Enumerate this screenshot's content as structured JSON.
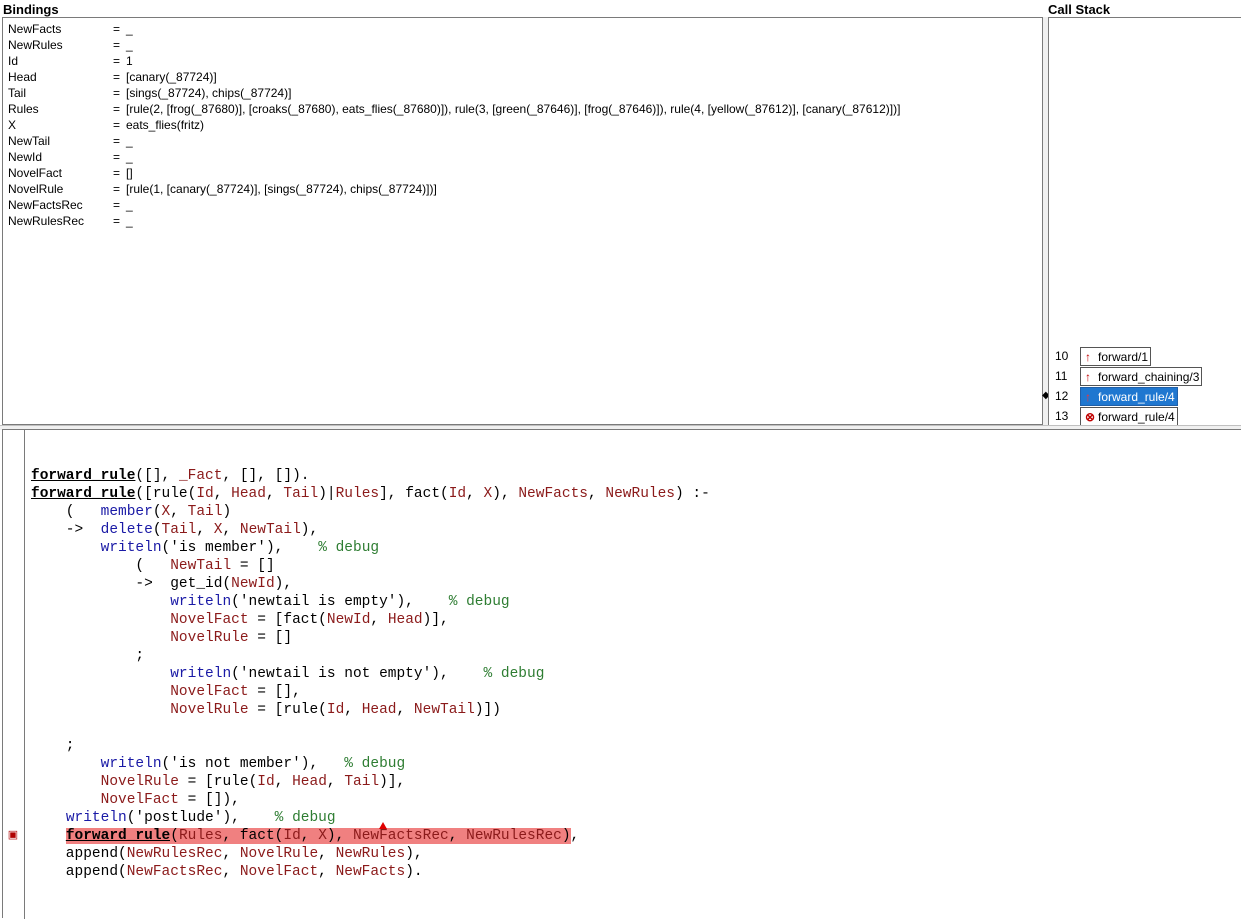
{
  "bindings": {
    "title": "Bindings",
    "rows": [
      {
        "name": "NewFacts",
        "eq": "=",
        "value": "_"
      },
      {
        "name": "NewRules",
        "eq": "=",
        "value": "_"
      },
      {
        "name": "Id",
        "eq": "=",
        "value": "1"
      },
      {
        "name": "Head",
        "eq": "=",
        "value": "[canary(_87724)]"
      },
      {
        "name": "Tail",
        "eq": "=",
        "value": "[sings(_87724), chips(_87724)]"
      },
      {
        "name": "Rules",
        "eq": "=",
        "value": "[rule(2, [frog(_87680)], [croaks(_87680), eats_flies(_87680)]), rule(3, [green(_87646)], [frog(_87646)]), rule(4, [yellow(_87612)], [canary(_87612)])]"
      },
      {
        "name": "X",
        "eq": "=",
        "value": "eats_flies(fritz)"
      },
      {
        "name": "NewTail",
        "eq": "=",
        "value": "_"
      },
      {
        "name": "NewId",
        "eq": "=",
        "value": "_"
      },
      {
        "name": "NovelFact",
        "eq": "=",
        "value": "[]"
      },
      {
        "name": "NovelRule",
        "eq": "=",
        "value": "[rule(1, [canary(_87724)], [sings(_87724), chips(_87724)])]"
      },
      {
        "name": "NewFactsRec",
        "eq": "=",
        "value": "_"
      },
      {
        "name": "NewRulesRec",
        "eq": "=",
        "value": "_"
      }
    ]
  },
  "call_stack": {
    "title": "Call Stack",
    "frames": [
      {
        "depth": "10",
        "label": "forward/1",
        "icon": "↑",
        "icon_name": "up-arrow-icon",
        "selected": false
      },
      {
        "depth": "11",
        "label": "forward_chaining/3",
        "icon": "↑",
        "icon_name": "up-arrow-icon",
        "selected": false
      },
      {
        "depth": "12",
        "label": "forward_rule/4",
        "icon": "↑",
        "icon_name": "up-arrow-icon",
        "selected": true
      },
      {
        "depth": "13",
        "label": "forward_rule/4",
        "icon": "⊗",
        "icon_name": "call-port-icon",
        "selected": false
      }
    ]
  },
  "source": {
    "gutter_marker": "▣",
    "lines": [
      [
        {
          "t": "forward_rule",
          "c": "kw"
        },
        {
          "t": "([], ",
          "c": "plain"
        },
        {
          "t": "_Fact",
          "c": "var"
        },
        {
          "t": ", [], []).",
          "c": "plain"
        }
      ],
      [
        {
          "t": "forward_rule",
          "c": "kw"
        },
        {
          "t": "([rule(",
          "c": "plain"
        },
        {
          "t": "Id",
          "c": "var"
        },
        {
          "t": ", ",
          "c": "plain"
        },
        {
          "t": "Head",
          "c": "var"
        },
        {
          "t": ", ",
          "c": "plain"
        },
        {
          "t": "Tail",
          "c": "var"
        },
        {
          "t": ")|",
          "c": "plain"
        },
        {
          "t": "Rules",
          "c": "var"
        },
        {
          "t": "], fact(",
          "c": "plain"
        },
        {
          "t": "Id",
          "c": "var"
        },
        {
          "t": ", ",
          "c": "plain"
        },
        {
          "t": "X",
          "c": "var"
        },
        {
          "t": "), ",
          "c": "plain"
        },
        {
          "t": "NewFacts",
          "c": "var"
        },
        {
          "t": ", ",
          "c": "plain"
        },
        {
          "t": "NewRules",
          "c": "var"
        },
        {
          "t": ") :-",
          "c": "plain"
        }
      ],
      [
        {
          "t": "    (   ",
          "c": "plain"
        },
        {
          "t": "member",
          "c": "bi"
        },
        {
          "t": "(",
          "c": "plain"
        },
        {
          "t": "X",
          "c": "var"
        },
        {
          "t": ", ",
          "c": "plain"
        },
        {
          "t": "Tail",
          "c": "var"
        },
        {
          "t": ")",
          "c": "plain"
        }
      ],
      [
        {
          "t": "    ->  ",
          "c": "plain"
        },
        {
          "t": "delete",
          "c": "bi"
        },
        {
          "t": "(",
          "c": "plain"
        },
        {
          "t": "Tail",
          "c": "var"
        },
        {
          "t": ", ",
          "c": "plain"
        },
        {
          "t": "X",
          "c": "var"
        },
        {
          "t": ", ",
          "c": "plain"
        },
        {
          "t": "NewTail",
          "c": "var"
        },
        {
          "t": "),",
          "c": "plain"
        }
      ],
      [
        {
          "t": "        ",
          "c": "plain"
        },
        {
          "t": "writeln",
          "c": "bi"
        },
        {
          "t": "('is member'),    ",
          "c": "plain"
        },
        {
          "t": "% debug",
          "c": "cmt"
        }
      ],
      [
        {
          "t": "            (   ",
          "c": "plain"
        },
        {
          "t": "NewTail",
          "c": "var"
        },
        {
          "t": " = []",
          "c": "plain"
        }
      ],
      [
        {
          "t": "            ->  get_id(",
          "c": "plain"
        },
        {
          "t": "NewId",
          "c": "var"
        },
        {
          "t": "),",
          "c": "plain"
        }
      ],
      [
        {
          "t": "                ",
          "c": "plain"
        },
        {
          "t": "writeln",
          "c": "bi"
        },
        {
          "t": "('newtail is empty'),    ",
          "c": "plain"
        },
        {
          "t": "% debug",
          "c": "cmt"
        }
      ],
      [
        {
          "t": "                ",
          "c": "plain"
        },
        {
          "t": "NovelFact",
          "c": "var"
        },
        {
          "t": " = [fact(",
          "c": "plain"
        },
        {
          "t": "NewId",
          "c": "var"
        },
        {
          "t": ", ",
          "c": "plain"
        },
        {
          "t": "Head",
          "c": "var"
        },
        {
          "t": ")],",
          "c": "plain"
        }
      ],
      [
        {
          "t": "                ",
          "c": "plain"
        },
        {
          "t": "NovelRule",
          "c": "var"
        },
        {
          "t": " = []",
          "c": "plain"
        }
      ],
      [
        {
          "t": "            ;",
          "c": "plain"
        }
      ],
      [
        {
          "t": "                ",
          "c": "plain"
        },
        {
          "t": "writeln",
          "c": "bi"
        },
        {
          "t": "('newtail is not empty'),    ",
          "c": "plain"
        },
        {
          "t": "% debug",
          "c": "cmt"
        }
      ],
      [
        {
          "t": "                ",
          "c": "plain"
        },
        {
          "t": "NovelFact",
          "c": "var"
        },
        {
          "t": " = [],",
          "c": "plain"
        }
      ],
      [
        {
          "t": "                ",
          "c": "plain"
        },
        {
          "t": "NovelRule",
          "c": "var"
        },
        {
          "t": " = [rule(",
          "c": "plain"
        },
        {
          "t": "Id",
          "c": "var"
        },
        {
          "t": ", ",
          "c": "plain"
        },
        {
          "t": "Head",
          "c": "var"
        },
        {
          "t": ", ",
          "c": "plain"
        },
        {
          "t": "NewTail",
          "c": "var"
        },
        {
          "t": ")])",
          "c": "plain"
        }
      ],
      [],
      [
        {
          "t": "    ;",
          "c": "plain"
        }
      ],
      [
        {
          "t": "        ",
          "c": "plain"
        },
        {
          "t": "writeln",
          "c": "bi"
        },
        {
          "t": "('is not member'),   ",
          "c": "plain"
        },
        {
          "t": "% debug",
          "c": "cmt"
        }
      ],
      [
        {
          "t": "        ",
          "c": "plain"
        },
        {
          "t": "NovelRule",
          "c": "var"
        },
        {
          "t": " = [rule(",
          "c": "plain"
        },
        {
          "t": "Id",
          "c": "var"
        },
        {
          "t": ", ",
          "c": "plain"
        },
        {
          "t": "Head",
          "c": "var"
        },
        {
          "t": ", ",
          "c": "plain"
        },
        {
          "t": "Tail",
          "c": "var"
        },
        {
          "t": ")],",
          "c": "plain"
        }
      ],
      [
        {
          "t": "        ",
          "c": "plain"
        },
        {
          "t": "NovelFact",
          "c": "var"
        },
        {
          "t": " = []),",
          "c": "plain"
        }
      ],
      [
        {
          "t": "    ",
          "c": "plain"
        },
        {
          "t": "writeln",
          "c": "bi"
        },
        {
          "t": "('postlude'),    ",
          "c": "plain"
        },
        {
          "t": "% debug",
          "c": "cmt"
        }
      ],
      [
        {
          "t": "    ",
          "c": "plain"
        },
        {
          "t": "forward_rule",
          "c": "kw hl"
        },
        {
          "t": "(",
          "c": "plain hl"
        },
        {
          "t": "Rules",
          "c": "var hl"
        },
        {
          "t": ", fact(",
          "c": "plain hl"
        },
        {
          "t": "Id",
          "c": "var hl"
        },
        {
          "t": ", ",
          "c": "plain hl"
        },
        {
          "t": "X",
          "c": "var hl"
        },
        {
          "t": "), ",
          "c": "plain hl"
        },
        {
          "t": "NewFactsRec",
          "c": "var hl"
        },
        {
          "t": ", ",
          "c": "plain hl"
        },
        {
          "t": "NewRulesRec",
          "c": "var hl"
        },
        {
          "t": ")",
          "c": "plain hl"
        },
        {
          "t": ",",
          "c": "plain"
        }
      ],
      [
        {
          "t": "    append(",
          "c": "plain"
        },
        {
          "t": "NewRulesRec",
          "c": "var"
        },
        {
          "t": ", ",
          "c": "plain"
        },
        {
          "t": "NovelRule",
          "c": "var"
        },
        {
          "t": ", ",
          "c": "plain"
        },
        {
          "t": "NewRules",
          "c": "var"
        },
        {
          "t": "),",
          "c": "plain"
        }
      ],
      [
        {
          "t": "    append(",
          "c": "plain"
        },
        {
          "t": "NewFactsRec",
          "c": "var"
        },
        {
          "t": ", ",
          "c": "plain"
        },
        {
          "t": "NovelFact",
          "c": "var"
        },
        {
          "t": ", ",
          "c": "plain"
        },
        {
          "t": "NewFacts",
          "c": "var"
        },
        {
          "t": ").",
          "c": "plain"
        }
      ]
    ]
  }
}
